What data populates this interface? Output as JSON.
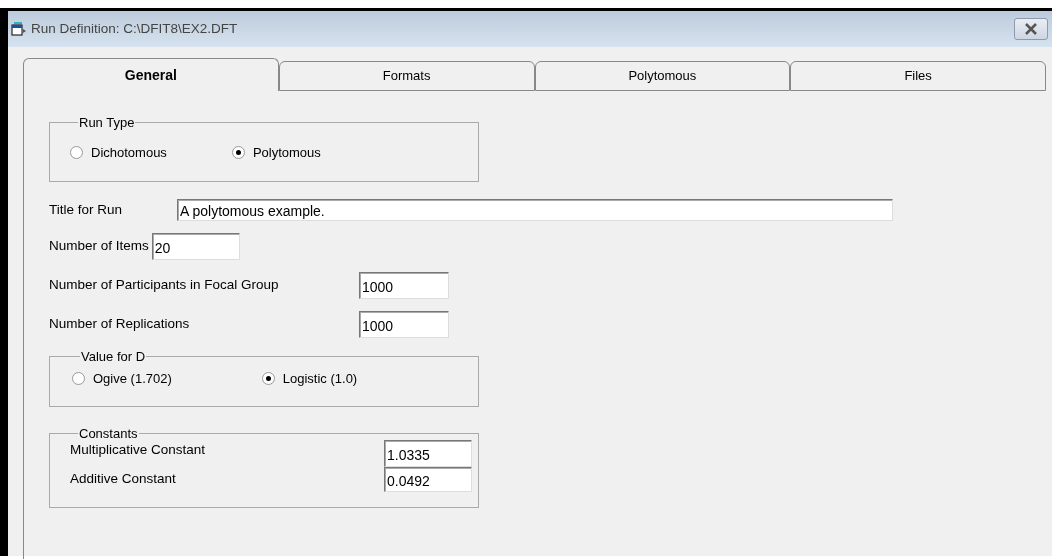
{
  "window": {
    "title": "Run Definition: C:\\DFIT8\\EX2.DFT"
  },
  "tabs": [
    {
      "label": "General",
      "selected": true
    },
    {
      "label": "Formats",
      "selected": false
    },
    {
      "label": "Polytomous",
      "selected": false
    },
    {
      "label": "Files",
      "selected": false
    }
  ],
  "run_type": {
    "label": "Run Type",
    "options": [
      {
        "label": "Dichotomous",
        "selected": false
      },
      {
        "label": "Polytomous",
        "selected": true
      }
    ]
  },
  "fields": [
    {
      "kind": "wide",
      "label": "Title for Run",
      "value": "A polytomous example."
    },
    {
      "kind": "inline",
      "label": "Number of Items",
      "value": "20"
    },
    {
      "kind": "aligned",
      "label": "Number of Participants in Focal Group",
      "value": "1000"
    },
    {
      "kind": "aligned",
      "label": "Number of Replications",
      "value": "1000"
    }
  ],
  "value_for_d": {
    "label": "Value for D",
    "options": [
      {
        "label": "Ogive (1.702)",
        "selected": false
      },
      {
        "label": "Logistic (1.0)",
        "selected": true
      }
    ]
  },
  "constants": {
    "label": "Constants",
    "fields": [
      {
        "label": "Multiplicative Constant",
        "value": "1.0335"
      },
      {
        "label": "Additive Constant",
        "value": "0.0492"
      }
    ]
  }
}
